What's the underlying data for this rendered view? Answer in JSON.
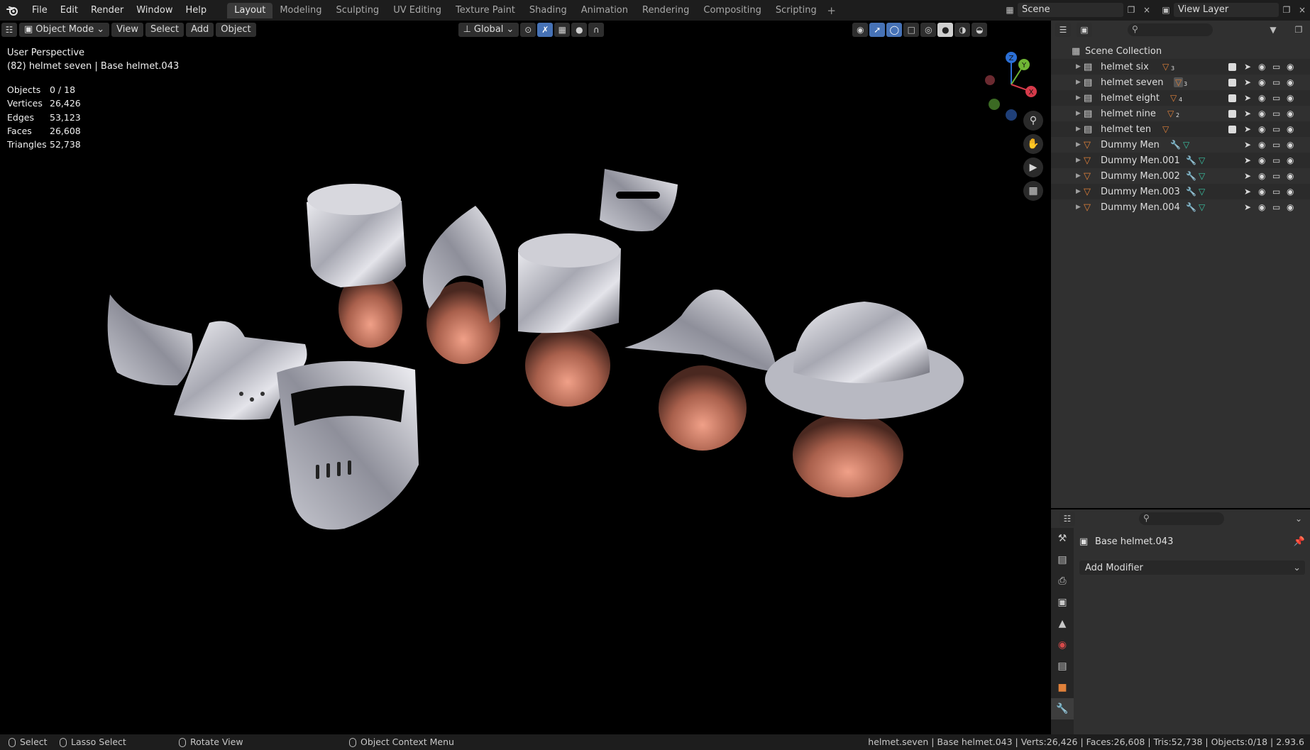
{
  "menu": {
    "items": [
      "File",
      "Edit",
      "Render",
      "Window",
      "Help"
    ]
  },
  "workspaces": {
    "tabs": [
      "Layout",
      "Modeling",
      "Sculpting",
      "UV Editing",
      "Texture Paint",
      "Shading",
      "Animation",
      "Rendering",
      "Compositing",
      "Scripting"
    ],
    "active": "Layout",
    "add_label": "+"
  },
  "scene": {
    "label": "Scene",
    "close": "×"
  },
  "view_layer": {
    "label": "View Layer",
    "close": "×"
  },
  "viewport": {
    "mode_label": "Object Mode",
    "menus": [
      "View",
      "Select",
      "Add",
      "Object"
    ],
    "orientation_label": "Global",
    "overlay": {
      "perspective": "User Perspective",
      "context": "(82) helmet seven | Base helmet.043"
    },
    "stats": [
      {
        "k": "Objects",
        "v": "0 / 18"
      },
      {
        "k": "Vertices",
        "v": "26,426"
      },
      {
        "k": "Edges",
        "v": "53,123"
      },
      {
        "k": "Faces",
        "v": "26,608"
      },
      {
        "k": "Triangles",
        "v": "52,738"
      }
    ],
    "gizmo": {
      "z": "Z",
      "y": "Y",
      "x": "X"
    }
  },
  "outliner": {
    "root": "Scene Collection",
    "rows": [
      {
        "name": "helmet six",
        "badge": "3",
        "kind": "collection"
      },
      {
        "name": "helmet seven",
        "badge": "3",
        "kind": "collection"
      },
      {
        "name": "helmet eight",
        "badge": "4",
        "kind": "collection"
      },
      {
        "name": "helmet nine",
        "badge": "2",
        "kind": "collection"
      },
      {
        "name": "helmet ten",
        "badge": "",
        "kind": "collection"
      },
      {
        "name": "Dummy Men",
        "badge": "",
        "kind": "mesh"
      },
      {
        "name": "Dummy Men.001",
        "badge": "",
        "kind": "mesh"
      },
      {
        "name": "Dummy Men.002",
        "badge": "",
        "kind": "mesh"
      },
      {
        "name": "Dummy Men.003",
        "badge": "",
        "kind": "mesh"
      },
      {
        "name": "Dummy Men.004",
        "badge": "",
        "kind": "mesh"
      }
    ]
  },
  "properties": {
    "object_name": "Base helmet.043",
    "add_modifier": "Add Modifier"
  },
  "statusbar": {
    "select": "Select",
    "lasso": "Lasso Select",
    "rotate": "Rotate View",
    "context_menu": "Object Context Menu",
    "info": "helmet.seven | Base helmet.043 | Verts:26,426 | Faces:26,608 | Tris:52,738 | Objects:0/18 | 2.93.6"
  },
  "colors": {
    "accent": "#4672b6",
    "panel": "#303030",
    "header": "#1d1d1d",
    "mesh_orange": "#e0813a",
    "modifier_blue": "#6fa0e6",
    "data_green": "#39c3a3"
  }
}
